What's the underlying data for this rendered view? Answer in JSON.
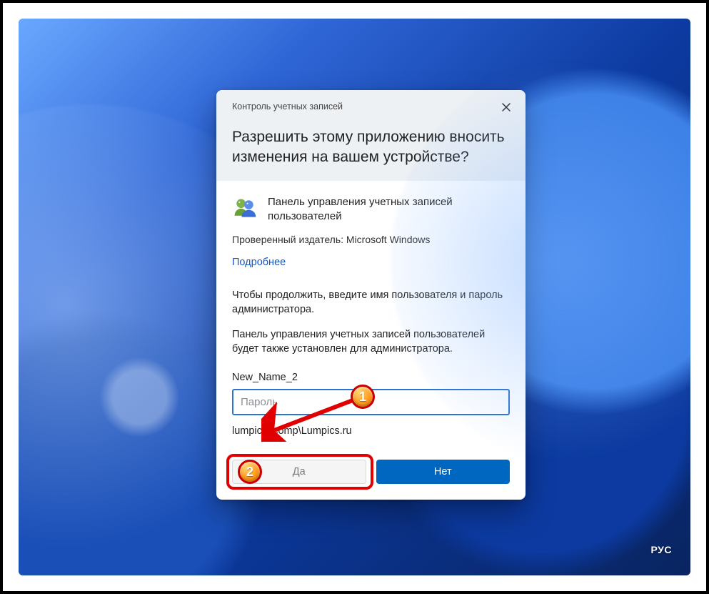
{
  "dialog": {
    "caption": "Контроль учетных записей",
    "title": "Разрешить этому приложению вносить изменения на вашем устройстве?",
    "app_name": "Панель управления учетных записей пользователей",
    "publisher_line": "Проверенный издатель: Microsoft Windows",
    "show_more": "Подробнее",
    "instruction_1": "Чтобы продолжить, введите имя пользователя и пароль администратора.",
    "instruction_2": "Панель управления учетных записей пользователей будет также установлен для администратора.",
    "username": "New_Name_2",
    "password_placeholder": "Пароль",
    "domain_user": "lumpics_comp\\Lumpics.ru",
    "btn_yes": "Да",
    "btn_no": "Нет"
  },
  "annotations": {
    "badge1": "1",
    "badge2": "2"
  },
  "ime": "РУС"
}
